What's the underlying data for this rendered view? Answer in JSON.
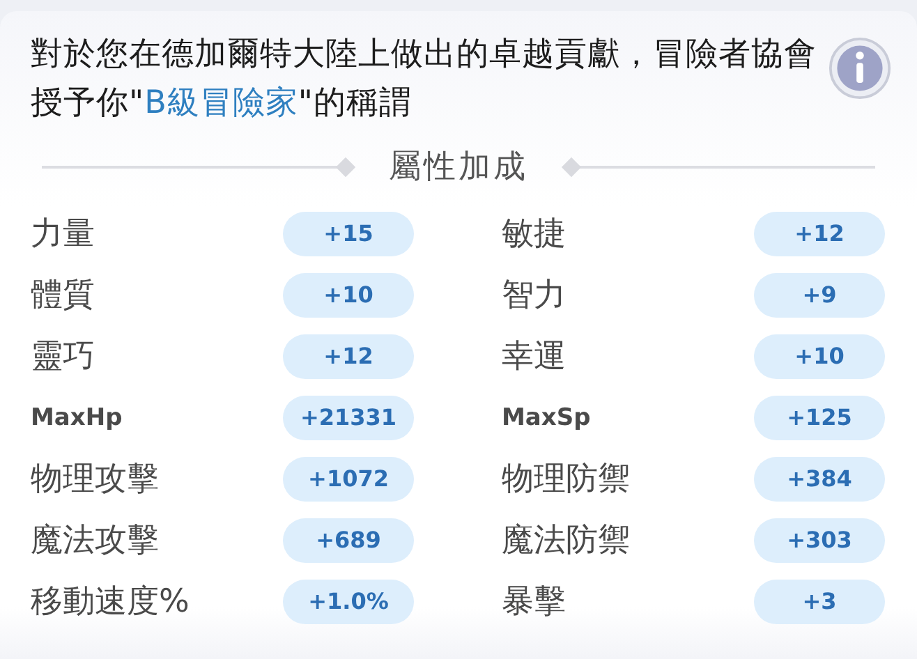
{
  "message": [
    {
      "kind": "plain",
      "text": "對於您在德加爾特大陸上做出的卓越貢獻，冒險者協會授予你\""
    },
    {
      "kind": "highlight",
      "text": "B級冒險家"
    },
    {
      "kind": "plain",
      "text": "\"的稱謂"
    }
  ],
  "section_title": "屬性加成",
  "stats": [
    {
      "kind": "word",
      "label": "力量",
      "value": "+15"
    },
    {
      "kind": "word",
      "label": "敏捷",
      "value": "+12"
    },
    {
      "kind": "word",
      "label": "體質",
      "value": "+10"
    },
    {
      "kind": "word",
      "label": "智力",
      "value": "+9"
    },
    {
      "kind": "word",
      "label": "靈巧",
      "value": "+12"
    },
    {
      "kind": "word",
      "label": "幸運",
      "value": "+10"
    },
    {
      "kind": "abbrev",
      "label": "MaxHp",
      "value": "+21331"
    },
    {
      "kind": "abbrev",
      "label": "MaxSp",
      "value": "+125"
    },
    {
      "kind": "word",
      "label": "物理攻擊",
      "value": "+1072"
    },
    {
      "kind": "word",
      "label": "物理防禦",
      "value": "+384"
    },
    {
      "kind": "word",
      "label": "魔法攻擊",
      "value": "+689"
    },
    {
      "kind": "word",
      "label": "魔法防禦",
      "value": "+303"
    },
    {
      "kind": "word",
      "label": "移動速度%",
      "value": "+1.0%"
    },
    {
      "kind": "word",
      "label": "暴擊",
      "value": "+3"
    }
  ]
}
